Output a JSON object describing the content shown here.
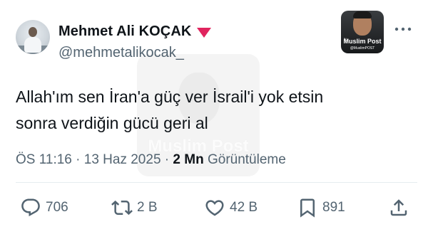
{
  "author": {
    "name": "Mehmet Ali KOÇAK",
    "handle": "@mehmetalikocak_",
    "badge_color": "#e0245e"
  },
  "brand": {
    "line1": "Muslim Post",
    "line2": "@MuslimPOST"
  },
  "watermark": {
    "text": "Muslim Post"
  },
  "tweet": {
    "line1": "Allah'ım sen İran'a güç ver İsrail'i yok etsin",
    "line2": "sonra verdiğin gücü geri al"
  },
  "meta": {
    "time": "ÖS 11:16",
    "sep1": "·",
    "date": "13 Haz 2025",
    "sep2": "·",
    "views_count": "2 Mn",
    "views_label": "Görüntüleme"
  },
  "actions": {
    "replies": "706",
    "retweets": "2 B",
    "likes": "42 B",
    "bookmarks": "891"
  },
  "colors": {
    "text": "#0f1419",
    "secondary": "#536471",
    "accent": "#1d9bf0"
  },
  "icons": [
    "more-icon",
    "reply-icon",
    "retweet-icon",
    "like-icon",
    "bookmark-icon",
    "share-icon"
  ]
}
